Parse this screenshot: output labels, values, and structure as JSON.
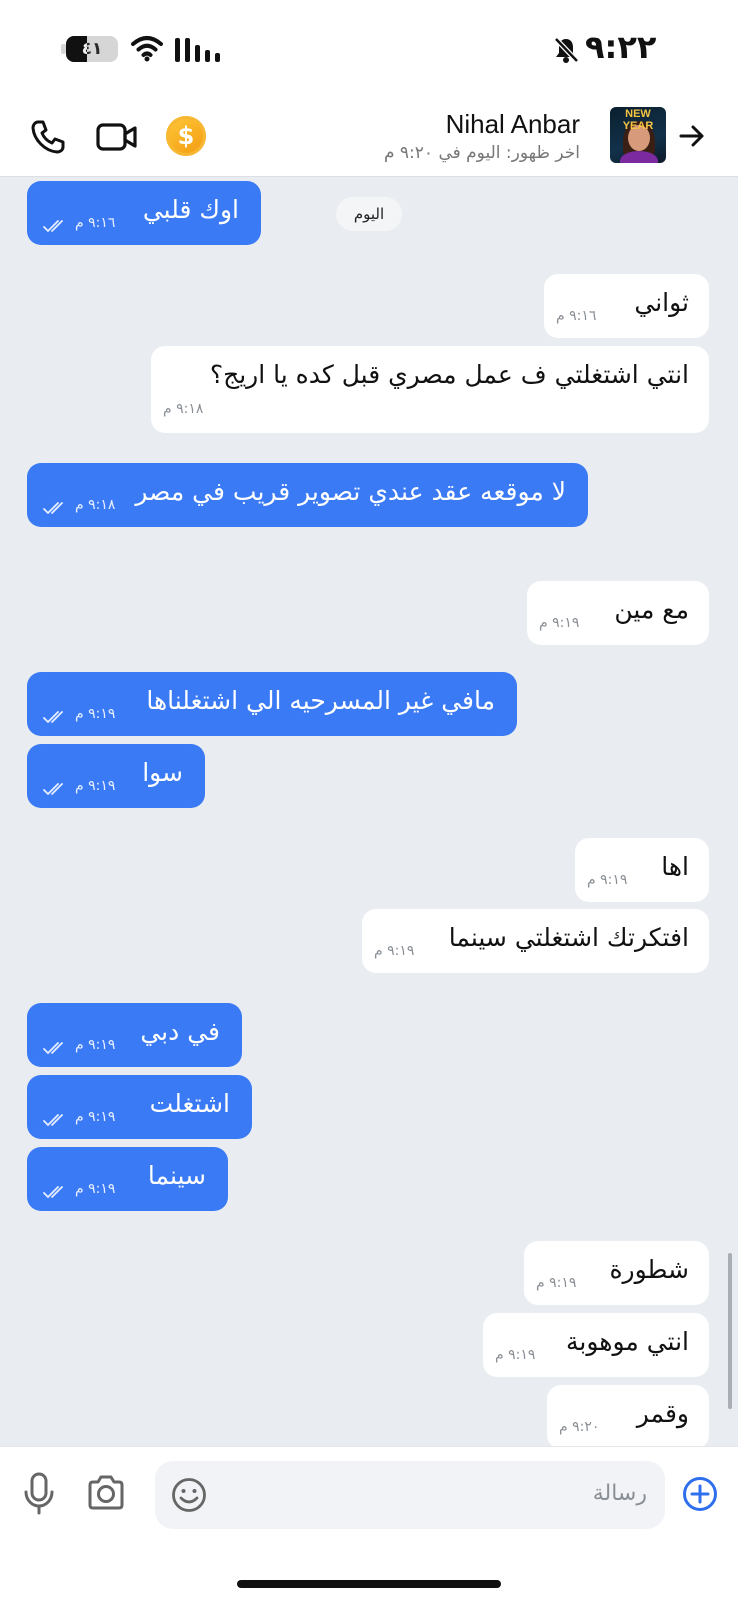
{
  "status_bar": {
    "time": "٩:٢٢",
    "battery": "٤١",
    "battery_level_percent": 41,
    "icons": [
      "battery-icon",
      "wifi-icon",
      "cellular-signal-icon",
      "bell-muted-icon"
    ]
  },
  "header": {
    "contact_name": "Nihal Anbar",
    "last_seen": "اخر ظهور: اليوم في ٩:٢٠ م",
    "avatar_text": "NEW YEAR",
    "icons": [
      "phone-icon",
      "video-call-icon",
      "coin-icon",
      "back-arrow-icon"
    ],
    "coin_symbol": "$"
  },
  "chat": {
    "date_separator": "اليوم",
    "messages": [
      {
        "direction": "out",
        "text": "اوك قلبي",
        "time": "٩:١٦ م",
        "status": "read"
      },
      {
        "direction": "in",
        "text": "ثواني",
        "time": "٩:١٦ م"
      },
      {
        "direction": "in",
        "text": "انتي اشتغلتي ف عمل مصري قبل كده يا اريج؟",
        "time": "٩:١٨ م"
      },
      {
        "direction": "out",
        "text": "لا موقعه عقد عندي تصوير قريب في مصر",
        "time": "٩:١٨ م",
        "status": "read"
      },
      {
        "direction": "in",
        "text": "مع مين",
        "time": "٩:١٩ م"
      },
      {
        "direction": "out",
        "text": "مافي غير المسرحيه الي اشتغلناها",
        "time": "٩:١٩ م",
        "status": "read"
      },
      {
        "direction": "out",
        "text": "سوا",
        "time": "٩:١٩ م",
        "status": "read"
      },
      {
        "direction": "in",
        "text": "اها",
        "time": "٩:١٩ م"
      },
      {
        "direction": "in",
        "text": "افتكرتك اشتغلتي سينما",
        "time": "٩:١٩ م"
      },
      {
        "direction": "out",
        "text": "في دبي",
        "time": "٩:١٩ م",
        "status": "read"
      },
      {
        "direction": "out",
        "text": "اشتغلت",
        "time": "٩:١٩ م",
        "status": "read"
      },
      {
        "direction": "out",
        "text": "سينما",
        "time": "٩:١٩ م",
        "status": "read"
      },
      {
        "direction": "in",
        "text": "شطورة",
        "time": "٩:١٩ م"
      },
      {
        "direction": "in",
        "text": "انتي موهوبة",
        "time": "٩:١٩ م"
      },
      {
        "direction": "in",
        "text": "وقمر",
        "time": "٩:٢٠ م"
      }
    ]
  },
  "input_bar": {
    "placeholder": "رسالة",
    "icons": [
      "microphone-icon",
      "camera-icon",
      "emoji-icon",
      "add-icon"
    ]
  },
  "colors": {
    "outgoing_bubble": "#3a7bf5",
    "incoming_bubble": "#ffffff",
    "chat_background": "#e9ecf1",
    "accent": "#2f6fed"
  }
}
